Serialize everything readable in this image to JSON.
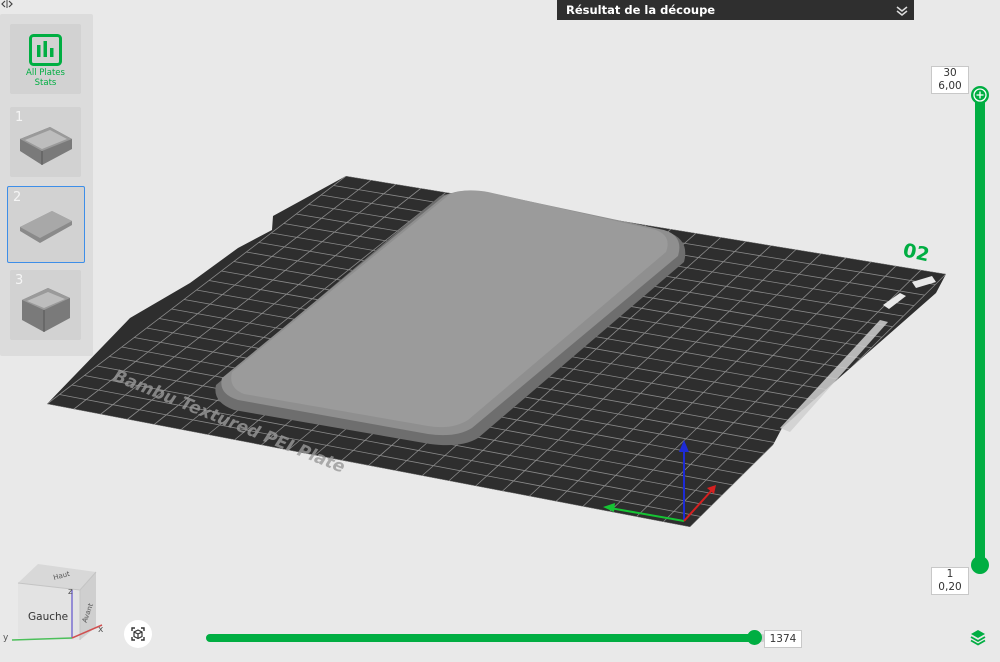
{
  "header": {
    "title": "Résultat de la découpe"
  },
  "sidebar": {
    "stats_label_line1": "All Plates",
    "stats_label_line2": "Stats",
    "plates": [
      {
        "number": "1"
      },
      {
        "number": "2"
      },
      {
        "number": "3"
      }
    ]
  },
  "bed": {
    "plate_number": "02",
    "brand_text": "Bambu Textured PEI Plate"
  },
  "layer_slider": {
    "top_layer": "30",
    "top_height": "6,00",
    "bottom_layer": "1",
    "bottom_height": "0,20"
  },
  "view_cube": {
    "face_label": "Gauche",
    "side_label": "Avant",
    "top_label": "Haut",
    "axis_x": "x",
    "axis_y": "y",
    "axis_z": "z"
  },
  "progress": {
    "value": "1374",
    "fraction": 0.98
  },
  "colors": {
    "accent": "#00ae42",
    "selected_border": "#3d8ee8",
    "bed": "#2e2e2e",
    "model": "#8f8f8f"
  },
  "icons": [
    "sidebar-toggle-icon",
    "collapse-chevrons-icon",
    "stats-chart-icon",
    "reset-view-icon",
    "layers-icon"
  ]
}
